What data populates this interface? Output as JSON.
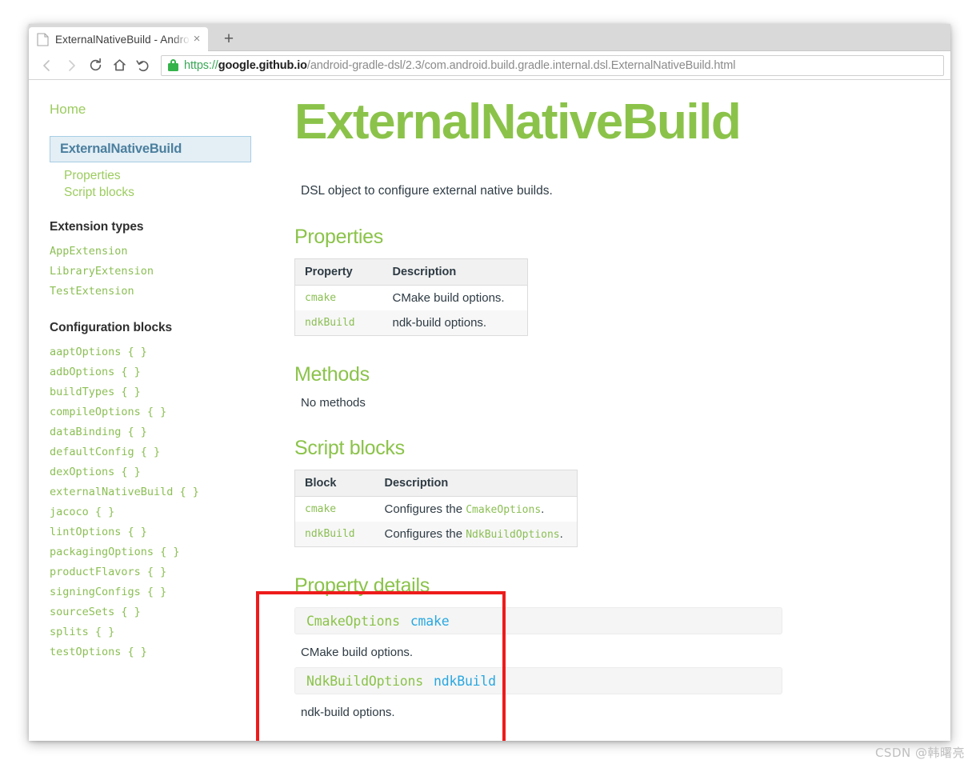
{
  "browser": {
    "tab": {
      "title": "ExternalNativeBuild - Android",
      "favicon": "page-icon",
      "close_label": "×"
    },
    "new_tab_label": "+",
    "toolbar": {
      "back": "back-arrow-icon",
      "forward": "forward-arrow-icon",
      "reload": "reload-icon",
      "home": "home-icon",
      "undo": "undo-arrow-icon",
      "lock": "lock-icon"
    },
    "url": {
      "scheme": "https://",
      "host": "google.github.io",
      "path": "/android-gradle-dsl/2.3/com.android.build.gradle.internal.dsl.ExternalNativeBuild.html",
      "full": "https://google.github.io/android-gradle-dsl/2.3/com.android.build.gradle.internal.dsl.ExternalNativeBuild.html"
    }
  },
  "sidebar": {
    "home_label": "Home",
    "current_page": "ExternalNativeBuild",
    "sub_items": [
      {
        "label": "Properties"
      },
      {
        "label": "Script blocks"
      }
    ],
    "extension_types_title": "Extension types",
    "extension_types": [
      {
        "label": "AppExtension"
      },
      {
        "label": "LibraryExtension"
      },
      {
        "label": "TestExtension"
      }
    ],
    "configuration_blocks_title": "Configuration blocks",
    "configuration_blocks": [
      {
        "label": "aaptOptions { }"
      },
      {
        "label": "adbOptions { }"
      },
      {
        "label": "buildTypes { }"
      },
      {
        "label": "compileOptions { }"
      },
      {
        "label": "dataBinding { }"
      },
      {
        "label": "defaultConfig { }"
      },
      {
        "label": "dexOptions { }"
      },
      {
        "label": "externalNativeBuild { }"
      },
      {
        "label": "jacoco { }"
      },
      {
        "label": "lintOptions { }"
      },
      {
        "label": "packagingOptions { }"
      },
      {
        "label": "productFlavors { }"
      },
      {
        "label": "signingConfigs { }"
      },
      {
        "label": "sourceSets { }"
      },
      {
        "label": "splits { }"
      },
      {
        "label": "testOptions { }"
      }
    ]
  },
  "content": {
    "title": "ExternalNativeBuild",
    "lead": "DSL object to configure external native builds.",
    "properties_section": {
      "heading": "Properties",
      "columns": [
        "Property",
        "Description"
      ],
      "rows": [
        {
          "property": "cmake",
          "description": "CMake build options."
        },
        {
          "property": "ndkBuild",
          "description": "ndk-build options."
        }
      ]
    },
    "methods_section": {
      "heading": "Methods",
      "empty_text": "No methods"
    },
    "script_blocks_section": {
      "heading": "Script blocks",
      "columns": [
        "Block",
        "Description"
      ],
      "rows": [
        {
          "block": "cmake",
          "desc_prefix": "Configures the ",
          "desc_code": "CmakeOptions",
          "desc_suffix": "."
        },
        {
          "block": "ndkBuild",
          "desc_prefix": "Configures the ",
          "desc_code": "NdkBuildOptions",
          "desc_suffix": "."
        }
      ]
    },
    "property_details_section": {
      "heading": "Property details",
      "entries": [
        {
          "type": "CmakeOptions",
          "name": "cmake",
          "description": "CMake build options."
        },
        {
          "type": "NdkBuildOptions",
          "name": "ndkBuild",
          "description": "ndk-build options."
        }
      ]
    }
  },
  "annotation": {
    "highlight_color": "#ee1b1b"
  },
  "watermark": {
    "text": "CSDN @韩曙亮"
  },
  "theme": {
    "accent_green": "#8bc34a",
    "link_green": "#9ccc5f",
    "code_green": "#8bbf54",
    "code_blue": "#29a8e0",
    "text_dark": "#2e3b44",
    "nav_active_bg": "#e3eef5",
    "nav_active_border": "#a8cde4",
    "nav_active_text": "#4b7f9e"
  }
}
